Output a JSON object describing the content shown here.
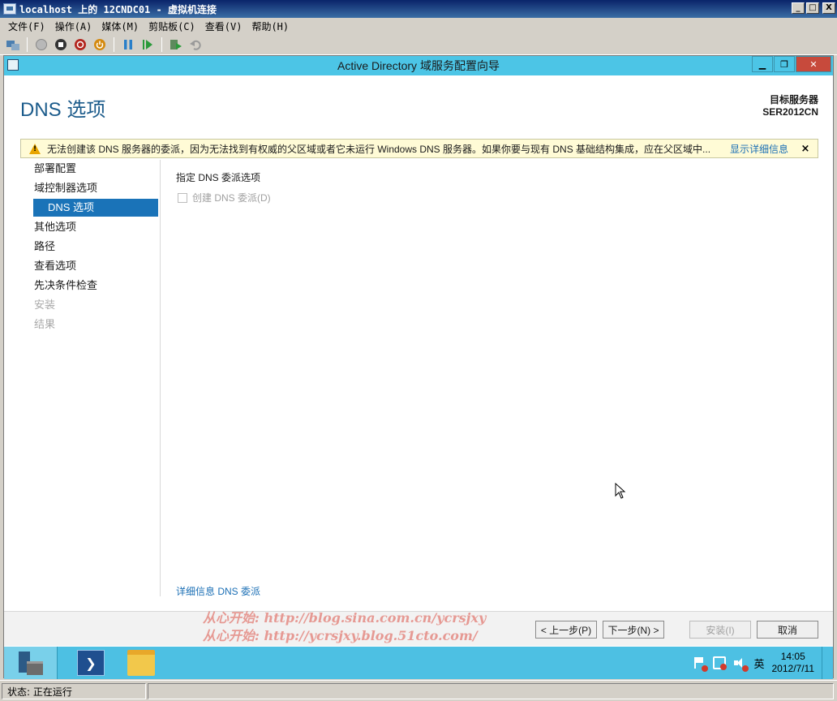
{
  "host": {
    "title": "localhost 上的 12CNDC01 - 虚拟机连接",
    "window_buttons": [
      "_",
      "□",
      "X"
    ],
    "menu": [
      "文件(F)",
      "操作(A)",
      "媒体(M)",
      "剪贴板(C)",
      "查看(V)",
      "帮助(H)"
    ],
    "toolbar_icons": [
      "ctrl-alt-del-icon",
      "start-icon",
      "turn-off-icon",
      "shutdown-icon",
      "power-icon",
      "pause-icon",
      "resume-icon",
      "checkpoint-icon",
      "revert-icon"
    ],
    "status_label": "状态: 正在运行"
  },
  "wizard": {
    "title": "Active Directory 域服务配置向导",
    "page_title": "DNS 选项",
    "target_server_label": "目标服务器",
    "target_server_name": "SER2012CN",
    "warning": {
      "message": "无法创建该 DNS 服务器的委派，因为无法找到有权威的父区域或者它未运行 Windows DNS 服务器。如果你要与现有 DNS 基础结构集成，应在父区域中...",
      "more_link": "显示详细信息",
      "dismiss": "×"
    },
    "nav": [
      {
        "label": "部署配置",
        "state": "normal"
      },
      {
        "label": "域控制器选项",
        "state": "normal"
      },
      {
        "label": "DNS 选项",
        "state": "active"
      },
      {
        "label": "其他选项",
        "state": "normal"
      },
      {
        "label": "路径",
        "state": "normal"
      },
      {
        "label": "查看选项",
        "state": "normal"
      },
      {
        "label": "先决条件检查",
        "state": "normal"
      },
      {
        "label": "安装",
        "state": "disabled"
      },
      {
        "label": "结果",
        "state": "disabled"
      }
    ],
    "content": {
      "heading": "指定 DNS 委派选项",
      "checkbox_label": "创建 DNS 委派(D)",
      "checkbox_checked": false,
      "more_info_link": "详细信息 DNS 委派"
    },
    "buttons": {
      "back": "< 上一步(P)",
      "next": "下一步(N) >",
      "install": "安装(I)",
      "cancel": "取消"
    },
    "watermark": [
      "从心开始: http://blog.sina.com.cn/ycrsjxy",
      "从心开始: http://ycrsjxy.blog.51cto.com/"
    ]
  },
  "taskbar": {
    "ime": "英",
    "time": "14:05",
    "date": "2012/7/11"
  }
}
